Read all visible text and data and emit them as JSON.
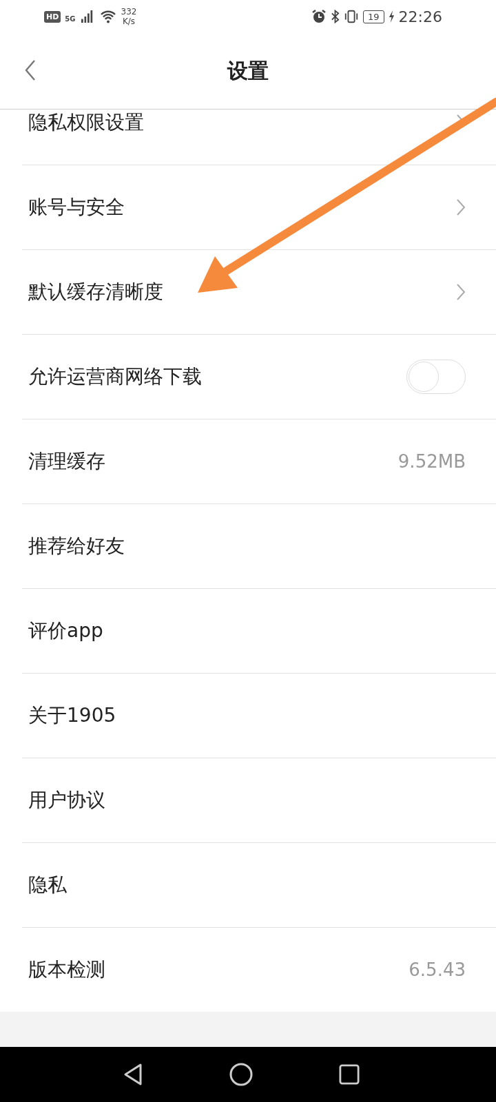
{
  "status_bar": {
    "hd": "HD",
    "network": "5G",
    "speed_value": "332",
    "speed_unit": "K/s",
    "battery": "19",
    "time": "22:26"
  },
  "header": {
    "title": "设置"
  },
  "items": [
    {
      "label": "隐私权限设置",
      "kind": "link"
    },
    {
      "label": "账号与安全",
      "kind": "link"
    },
    {
      "label": "默认缓存清晰度",
      "kind": "link"
    },
    {
      "label": "允许运营商网络下载",
      "kind": "toggle",
      "on": false
    },
    {
      "label": "清理缓存",
      "kind": "value",
      "value": "9.52MB"
    },
    {
      "label": "推荐给好友",
      "kind": "plain"
    },
    {
      "label": "评价app",
      "kind": "plain"
    },
    {
      "label": "关于1905",
      "kind": "plain"
    },
    {
      "label": "用户协议",
      "kind": "plain"
    },
    {
      "label": "隐私",
      "kind": "plain"
    },
    {
      "label": "版本检测",
      "kind": "value",
      "value": "6.5.43"
    }
  ]
}
